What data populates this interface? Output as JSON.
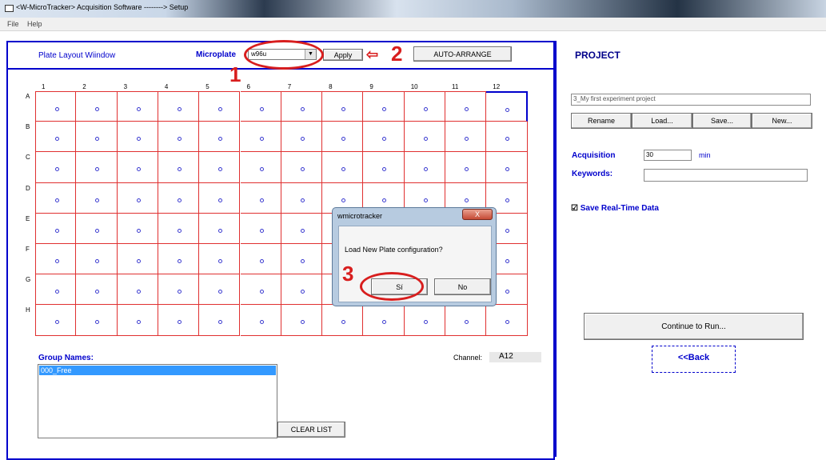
{
  "window": {
    "title": "<W-MicroTracker> Acquisition Software --------> Setup"
  },
  "menu": [
    "File",
    "Help"
  ],
  "plate_panel": {
    "title": "Plate Layout Wiindow",
    "microplate_label": "Microplate",
    "microplate_value": "w96u",
    "apply_label": "Apply",
    "auto_arrange_label": "AUTO-ARRANGE"
  },
  "grid": {
    "columns": [
      "1",
      "2",
      "3",
      "4",
      "5",
      "6",
      "7",
      "8",
      "9",
      "10",
      "11",
      "12"
    ],
    "rows": [
      "A",
      "B",
      "C",
      "D",
      "E",
      "F",
      "G",
      "H"
    ],
    "selected_cell": "A12"
  },
  "groups": {
    "label": "Group Names:",
    "items": [
      "000_Free"
    ],
    "clear_label": "CLEAR LIST"
  },
  "channel": {
    "label": "Channel:",
    "value": "A12"
  },
  "project": {
    "title": "PROJECT",
    "name_value": "3_My first experiment project",
    "rename_label": "Rename",
    "load_label": "Load...",
    "save_label": "Save...",
    "new_label": "New...",
    "acquisition_label": "Acquisition",
    "acquisition_value": "30",
    "acquisition_unit": "min",
    "keywords_label": "Keywords:",
    "keywords_value": "",
    "save_realtime_label": "Save Real-Time Data",
    "save_realtime_checked": true,
    "continue_label": "Continue to Run...",
    "back_label": "<<Back"
  },
  "dialog": {
    "title": "wmicrotracker",
    "message": "Load New Plate configuration?",
    "yes_label": "Sí",
    "no_label": "No",
    "close_glyph": "X"
  },
  "annotations": [
    "1",
    "2",
    "3"
  ],
  "colors": {
    "accent_blue": "#0000cc",
    "grid_red": "#e03030",
    "annotation_red": "#d81e1e",
    "selection_blue": "#3399ff"
  }
}
